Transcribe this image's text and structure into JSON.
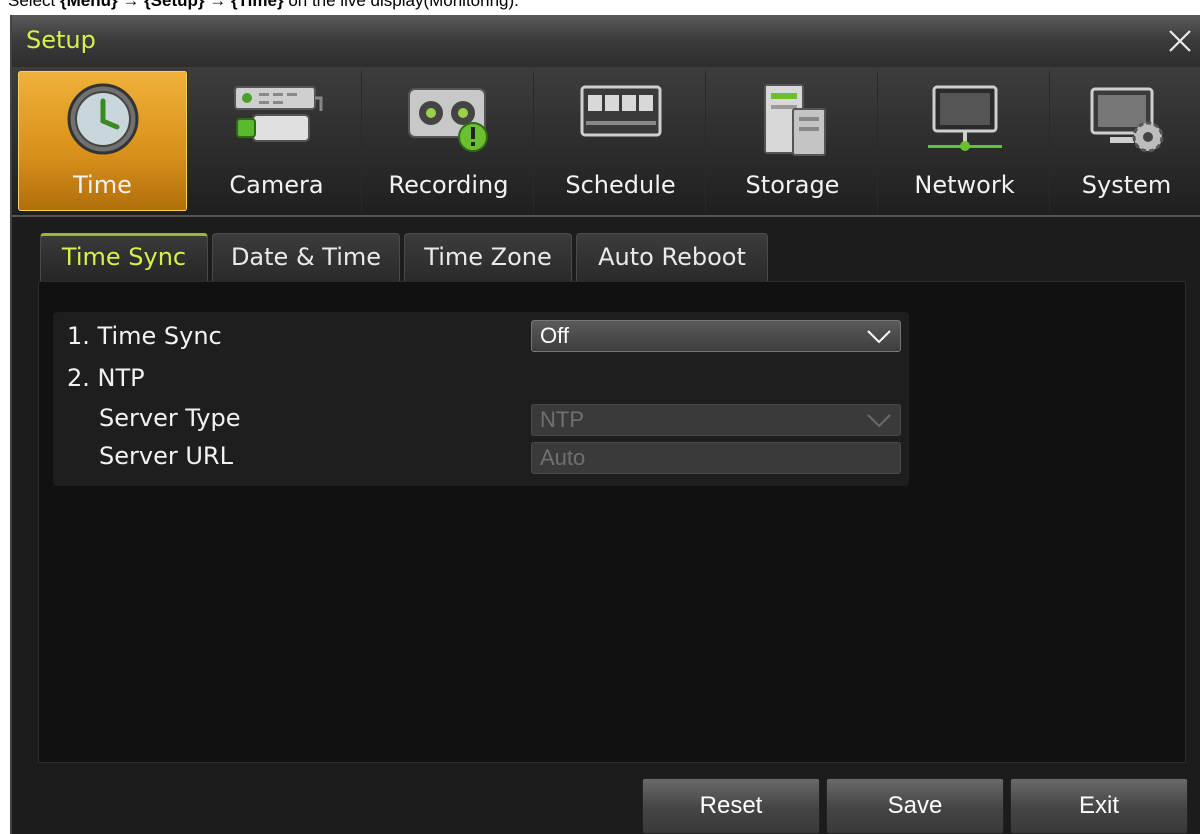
{
  "caption": {
    "prefix": "Select ",
    "menu": "{Menu}",
    "arrow1": " → ",
    "setup": "{Setup}",
    "arrow2": " → ",
    "time": "{Time}",
    "suffix": " on the live display(Monitoring)."
  },
  "window": {
    "title": "Setup"
  },
  "nav": {
    "active": "Time",
    "items": [
      {
        "label": "Time",
        "icon": "clock-icon"
      },
      {
        "label": "Camera",
        "icon": "camera-icon"
      },
      {
        "label": "Recording",
        "icon": "recording-icon"
      },
      {
        "label": "Schedule",
        "icon": "schedule-icon"
      },
      {
        "label": "Storage",
        "icon": "storage-icon"
      },
      {
        "label": "Network",
        "icon": "network-icon"
      },
      {
        "label": "System",
        "icon": "system-gear-icon"
      }
    ]
  },
  "tabs": [
    {
      "label": "Time Sync",
      "active": true
    },
    {
      "label": "Date & Time"
    },
    {
      "label": "Time Zone"
    },
    {
      "label": "Auto Reboot"
    }
  ],
  "settings": {
    "time_sync_label": "1. Time Sync",
    "time_sync_value": "Off",
    "ntp_label": "2. NTP",
    "server_type_label": "Server Type",
    "server_type_value": "NTP",
    "server_url_label": "Server URL",
    "server_url_value": "Auto"
  },
  "buttons": {
    "reset": "Reset",
    "save": "Save",
    "exit": "Exit"
  },
  "colors": {
    "accent": "#d8f04a",
    "active_nav": "#e8a22a",
    "background": "#1c1c1c"
  }
}
